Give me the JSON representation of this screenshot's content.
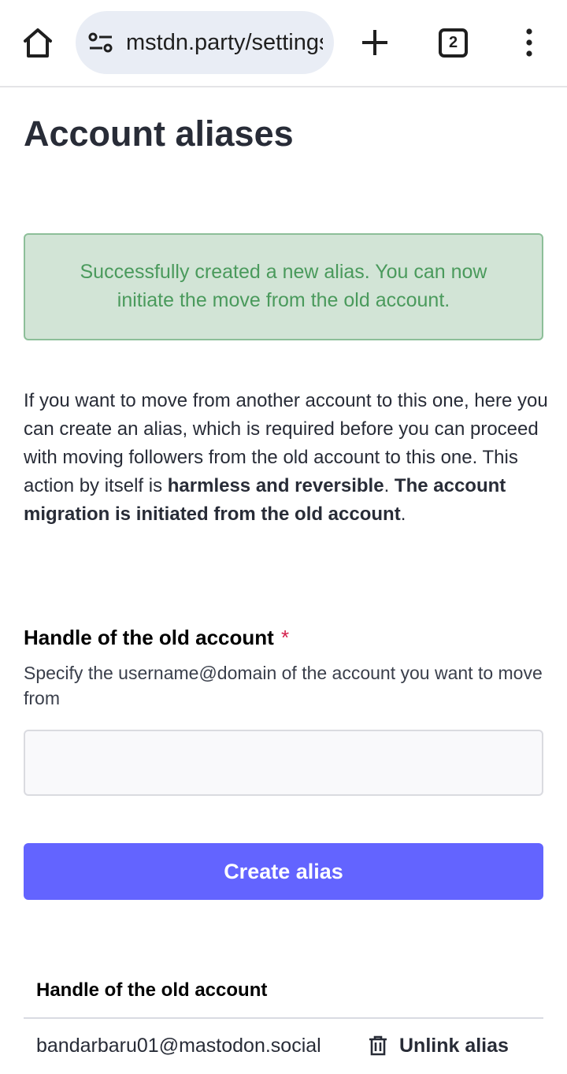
{
  "browser": {
    "url": "mstdn.party/settings/aliases",
    "tab_count": "2"
  },
  "page": {
    "title": "Account aliases"
  },
  "flash": {
    "line1": "Successfully created a new alias. You can now",
    "line2": "initiate the move from the old account."
  },
  "hint": {
    "part1": "If you want to move from another account to this one, here you can create an alias, which is required before you can proceed with moving followers from the old account to this one. This action by itself is ",
    "bold1": "harmless and reversible",
    "part2": ". ",
    "bold2": "The account migration is initiated from the old account",
    "part3": "."
  },
  "form": {
    "label": "Handle of the old account",
    "required_mark": "*",
    "hint": "Specify the username@domain of the account you want to move from",
    "value": "",
    "submit_label": "Create alias"
  },
  "table": {
    "header": "Handle of the old account",
    "rows": [
      {
        "handle": "bandarbaru01@mastodon.social",
        "action": "Unlink alias"
      }
    ]
  },
  "colors": {
    "accent": "#6364ff",
    "flash_bg": "#d2e4d6",
    "flash_text": "#4a9a5c",
    "required": "#d4204c"
  }
}
